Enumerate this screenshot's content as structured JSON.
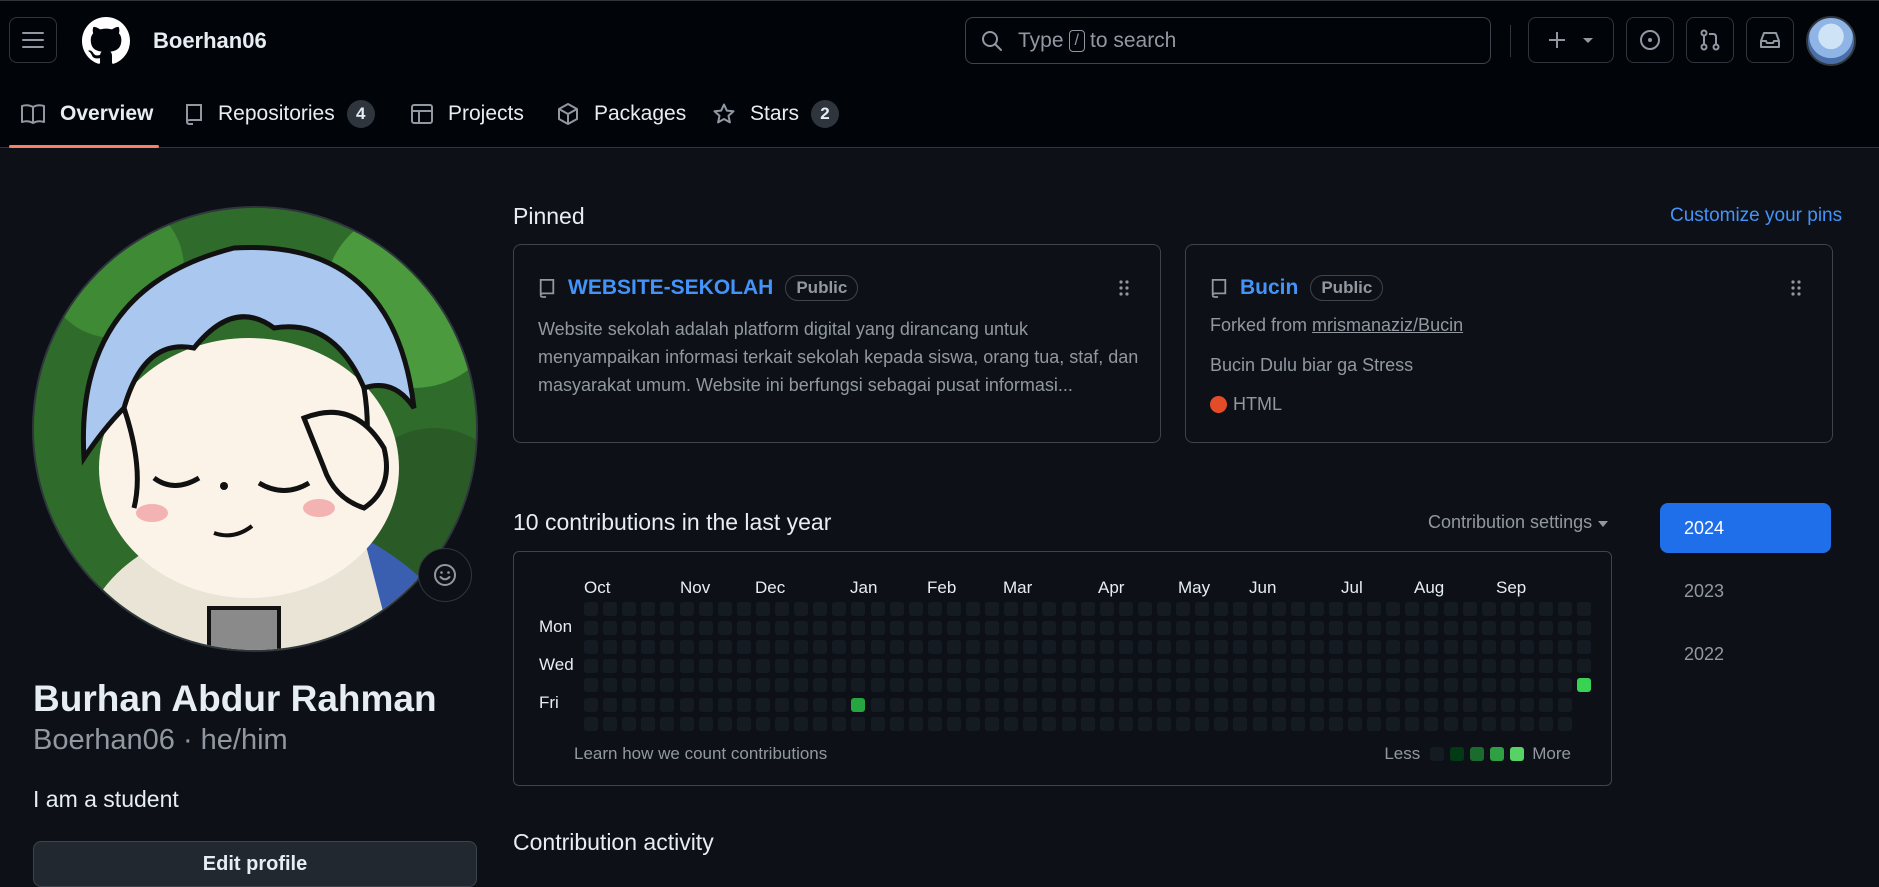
{
  "header": {
    "username": "Boerhan06",
    "search_prefix": "Type",
    "search_key": "/",
    "search_suffix": "to search",
    "icons": [
      "hamburger-icon",
      "github-logo",
      "search-icon",
      "plus-icon",
      "chevron-down-icon",
      "issue-icon",
      "pull-request-icon",
      "inbox-icon",
      "avatar"
    ]
  },
  "tabs": [
    {
      "label": "Overview",
      "icon": "book-icon",
      "active": true
    },
    {
      "label": "Repositories",
      "icon": "repo-icon",
      "count": "4"
    },
    {
      "label": "Projects",
      "icon": "table-icon"
    },
    {
      "label": "Packages",
      "icon": "package-icon"
    },
    {
      "label": "Stars",
      "icon": "star-icon",
      "count": "2"
    }
  ],
  "profile": {
    "full_name": "Burhan Abdur Rahman",
    "handle": "Boerhan06 · he/him",
    "bio": "I am a student",
    "edit_label": "Edit profile"
  },
  "pinned": {
    "title": "Pinned",
    "customize": "Customize your pins",
    "cards": [
      {
        "name": "WEBSITE-SEKOLAH",
        "visibility": "Public",
        "description": "Website sekolah adalah platform digital yang dirancang untuk menyampaikan informasi terkait sekolah kepada siswa, orang tua, staf, dan masyarakat umum. Website ini berfungsi sebagai pusat informasi..."
      },
      {
        "name": "Bucin",
        "visibility": "Public",
        "forked_prefix": "Forked from",
        "forked_from": "mrismanaziz/Bucin",
        "description": "Bucin Dulu biar ga Stress",
        "language": "HTML",
        "language_color": "#e34c26"
      }
    ]
  },
  "contributions": {
    "title": "10 contributions in the last year",
    "settings": "Contribution settings",
    "months": [
      "Oct",
      "Nov",
      "Dec",
      "Jan",
      "Feb",
      "Mar",
      "Apr",
      "May",
      "Jun",
      "Jul",
      "Aug",
      "Sep"
    ],
    "day_labels": [
      "Mon",
      "Wed",
      "Fri"
    ],
    "learn": "Learn how we count contributions",
    "legend_less": "Less",
    "legend_more": "More",
    "colors": {
      "empty": "#151b23",
      "l1": "#033a16",
      "l2": "#196c2e",
      "l3": "#2ea043",
      "l4": "#56d364"
    }
  },
  "years": {
    "list": [
      "2024",
      "2023",
      "2022"
    ],
    "selected": "2024"
  },
  "activity": {
    "title": "Contribution activity"
  }
}
